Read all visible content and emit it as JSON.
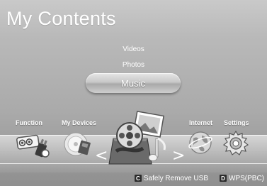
{
  "screen": {
    "title": "My Contents"
  },
  "menu": {
    "items": [
      {
        "label": "Videos"
      },
      {
        "label": "Photos"
      },
      {
        "label": "Music",
        "selected": true
      }
    ]
  },
  "categories": [
    {
      "label": "Function",
      "icon": "function-icon"
    },
    {
      "label": "My Devices",
      "icon": "devices-icon"
    },
    {
      "label": "",
      "icon": "my-contents-icon",
      "selected": true
    },
    {
      "label": "Internet",
      "icon": "internet-icon"
    },
    {
      "label": "Settings",
      "icon": "settings-icon"
    }
  ],
  "navigation": {
    "left_arrow": "<",
    "right_arrow": ">"
  },
  "footer": {
    "actions": [
      {
        "key": "C",
        "label": "Safely Remove USB"
      },
      {
        "key": "D",
        "label": "WPS(PBC)"
      }
    ]
  }
}
